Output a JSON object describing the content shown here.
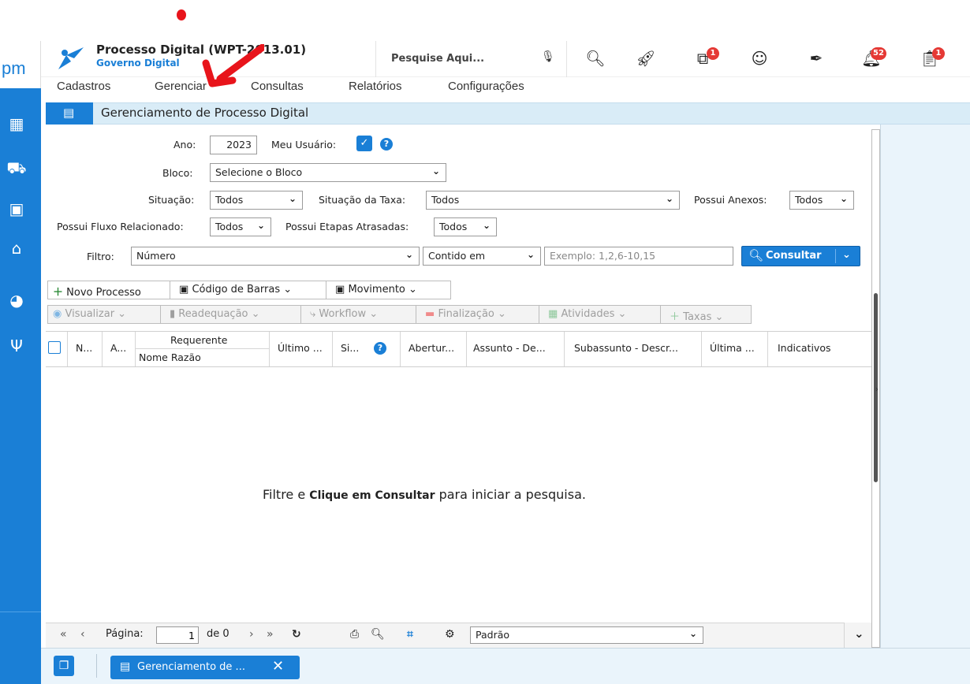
{
  "app": {
    "title": "Processo Digital (WPT-2013.01)",
    "subtitle": "Governo Digital",
    "logo_text": "pm"
  },
  "header": {
    "search_placeholder": "Pesquise Aqui...",
    "badges": {
      "hierarchy": "1",
      "notifications": "52",
      "tasks": "1"
    }
  },
  "menu": [
    "Cadastros",
    "Gerenciar",
    "Consultas",
    "Relatórios",
    "Configurações"
  ],
  "page": {
    "title": "Gerenciamento de Processo Digital"
  },
  "form": {
    "ano_label": "Ano:",
    "ano_value": "2023",
    "meu_usuario_label": "Meu Usuário:",
    "bloco_label": "Bloco:",
    "bloco_value": "Selecione o Bloco",
    "situacao_label": "Situação:",
    "situacao_value": "Todos",
    "situacao_taxa_label": "Situação da Taxa:",
    "situacao_taxa_value": "Todos",
    "possui_anexos_label": "Possui Anexos:",
    "possui_anexos_value": "Todos",
    "possui_fluxo_label": "Possui Fluxo Relacionado:",
    "possui_fluxo_value": "Todos",
    "possui_etapas_label": "Possui Etapas Atrasadas:",
    "possui_etapas_value": "Todos",
    "filtro_label": "Filtro:",
    "filtro_value": "Número",
    "operador_value": "Contido em",
    "valor_placeholder": "Exemplo: 1,2,6-10,15",
    "consultar_label": "Consultar"
  },
  "toolbar1": [
    "Novo Processo",
    "Código de Barras",
    "Movimento"
  ],
  "toolbar2": [
    "Visualizar",
    "Readequação",
    "Workflow",
    "Finalização",
    "Atividades",
    "Taxas"
  ],
  "grid": {
    "columns": [
      "N...",
      "A...",
      "Requerente",
      "Nome Razão",
      "Último ...",
      "Si...",
      "Abertur...",
      "Assunto - De...",
      "Subassunto - Descr...",
      "Última ...",
      "Indicativos"
    ],
    "empty_pre": "Filtre e ",
    "empty_bold": "Clique em Consultar",
    "empty_post": " para iniciar a pesquisa."
  },
  "pager": {
    "page_label": "Página:",
    "page_value": "1",
    "of_label": "de 0",
    "layout_value": "Padrão"
  },
  "taskbar": {
    "tab_label": "Gerenciamento de ..."
  },
  "colors": {
    "accent": "#1a7fd6",
    "title_bar": "#d9ecf7",
    "annotation": "#e8141b"
  }
}
